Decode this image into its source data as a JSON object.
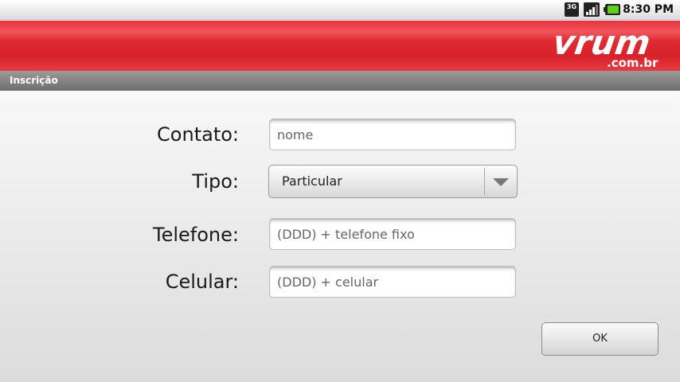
{
  "status_bar": {
    "time": "8:30 PM",
    "network_badge": "3G",
    "icons": [
      "network-3g-icon",
      "signal-icon",
      "battery-icon"
    ]
  },
  "brand": {
    "logo_main": "vrum",
    "logo_sub": ".com.br",
    "bar_color": "#e02b34"
  },
  "titlebar": {
    "title": "Inscrição"
  },
  "form": {
    "contato": {
      "label": "Contato:",
      "placeholder": "nome",
      "value": ""
    },
    "tipo": {
      "label": "Tipo:",
      "selected": "Particular",
      "icon": "chevron-down-icon"
    },
    "telefone": {
      "label": "Telefone:",
      "placeholder": "(DDD) + telefone fixo",
      "value": ""
    },
    "celular": {
      "label": "Celular:",
      "placeholder": "(DDD) + celular",
      "value": ""
    }
  },
  "actions": {
    "ok_label": "OK"
  }
}
